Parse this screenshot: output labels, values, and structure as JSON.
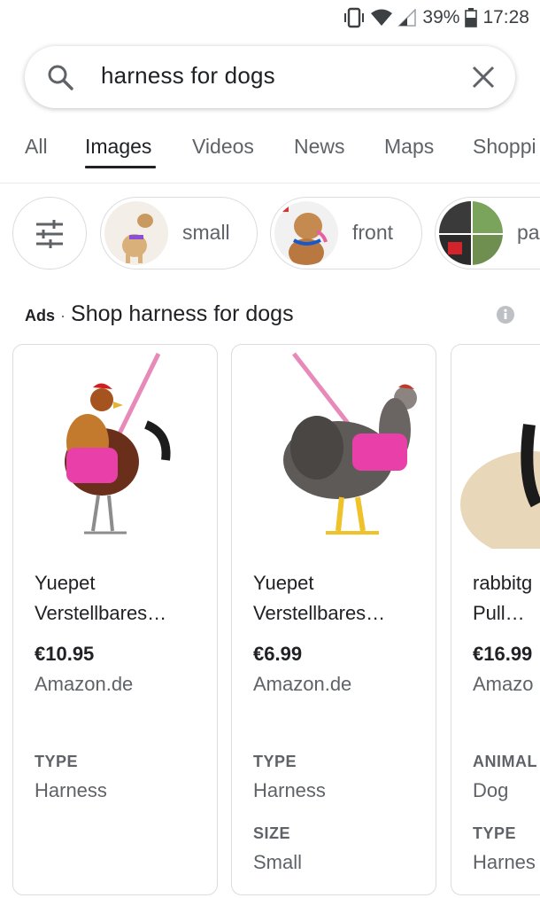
{
  "status_bar": {
    "battery": "39%",
    "time": "17:28"
  },
  "search": {
    "query": "harness for dogs"
  },
  "tabs": [
    {
      "label": "All"
    },
    {
      "label": "Images"
    },
    {
      "label": "Videos"
    },
    {
      "label": "News"
    },
    {
      "label": "Maps"
    },
    {
      "label": "Shoppi"
    }
  ],
  "chips": [
    {
      "label": "small"
    },
    {
      "label": "front"
    },
    {
      "label": "pa"
    }
  ],
  "ads": {
    "label": "Ads",
    "separator": "·",
    "title": "Shop harness for dogs"
  },
  "products": [
    {
      "name_line1": "Yuepet",
      "name_line2": "Verstellbares…",
      "price": "€10.95",
      "store": "Amazon.de",
      "attrs": [
        {
          "label": "TYPE",
          "value": "Harness"
        }
      ]
    },
    {
      "name_line1": "Yuepet",
      "name_line2": "Verstellbares…",
      "price": "€6.99",
      "store": "Amazon.de",
      "attrs": [
        {
          "label": "TYPE",
          "value": "Harness"
        },
        {
          "label": "SIZE",
          "value": "Small"
        }
      ]
    },
    {
      "name_line1": "rabbitg",
      "name_line2": "Pull…",
      "price": "€16.99",
      "store": "Amazo",
      "attrs": [
        {
          "label": "ANIMAL",
          "value": "Dog"
        },
        {
          "label": "TYPE",
          "value": "Harnes"
        }
      ]
    }
  ],
  "colors": {
    "accent": "#202124",
    "muted": "#5f6368",
    "border": "#dadce0",
    "harness_pink": "#e83fa8"
  }
}
